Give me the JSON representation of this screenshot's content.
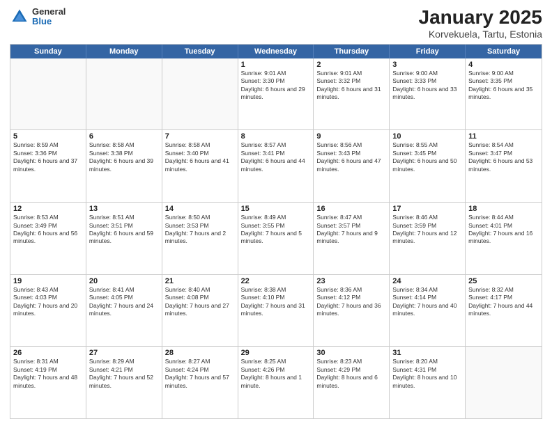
{
  "header": {
    "logo": {
      "general": "General",
      "blue": "Blue"
    },
    "title": "January 2025",
    "subtitle": "Korvekuela, Tartu, Estonia"
  },
  "weekdays": [
    "Sunday",
    "Monday",
    "Tuesday",
    "Wednesday",
    "Thursday",
    "Friday",
    "Saturday"
  ],
  "rows": [
    [
      {
        "day": "",
        "sunrise": "",
        "sunset": "",
        "daylight": "",
        "empty": true
      },
      {
        "day": "",
        "sunrise": "",
        "sunset": "",
        "daylight": "",
        "empty": true
      },
      {
        "day": "",
        "sunrise": "",
        "sunset": "",
        "daylight": "",
        "empty": true
      },
      {
        "day": "1",
        "sunrise": "Sunrise: 9:01 AM",
        "sunset": "Sunset: 3:30 PM",
        "daylight": "Daylight: 6 hours and 29 minutes."
      },
      {
        "day": "2",
        "sunrise": "Sunrise: 9:01 AM",
        "sunset": "Sunset: 3:32 PM",
        "daylight": "Daylight: 6 hours and 31 minutes."
      },
      {
        "day": "3",
        "sunrise": "Sunrise: 9:00 AM",
        "sunset": "Sunset: 3:33 PM",
        "daylight": "Daylight: 6 hours and 33 minutes."
      },
      {
        "day": "4",
        "sunrise": "Sunrise: 9:00 AM",
        "sunset": "Sunset: 3:35 PM",
        "daylight": "Daylight: 6 hours and 35 minutes."
      }
    ],
    [
      {
        "day": "5",
        "sunrise": "Sunrise: 8:59 AM",
        "sunset": "Sunset: 3:36 PM",
        "daylight": "Daylight: 6 hours and 37 minutes."
      },
      {
        "day": "6",
        "sunrise": "Sunrise: 8:58 AM",
        "sunset": "Sunset: 3:38 PM",
        "daylight": "Daylight: 6 hours and 39 minutes."
      },
      {
        "day": "7",
        "sunrise": "Sunrise: 8:58 AM",
        "sunset": "Sunset: 3:40 PM",
        "daylight": "Daylight: 6 hours and 41 minutes."
      },
      {
        "day": "8",
        "sunrise": "Sunrise: 8:57 AM",
        "sunset": "Sunset: 3:41 PM",
        "daylight": "Daylight: 6 hours and 44 minutes."
      },
      {
        "day": "9",
        "sunrise": "Sunrise: 8:56 AM",
        "sunset": "Sunset: 3:43 PM",
        "daylight": "Daylight: 6 hours and 47 minutes."
      },
      {
        "day": "10",
        "sunrise": "Sunrise: 8:55 AM",
        "sunset": "Sunset: 3:45 PM",
        "daylight": "Daylight: 6 hours and 50 minutes."
      },
      {
        "day": "11",
        "sunrise": "Sunrise: 8:54 AM",
        "sunset": "Sunset: 3:47 PM",
        "daylight": "Daylight: 6 hours and 53 minutes."
      }
    ],
    [
      {
        "day": "12",
        "sunrise": "Sunrise: 8:53 AM",
        "sunset": "Sunset: 3:49 PM",
        "daylight": "Daylight: 6 hours and 56 minutes."
      },
      {
        "day": "13",
        "sunrise": "Sunrise: 8:51 AM",
        "sunset": "Sunset: 3:51 PM",
        "daylight": "Daylight: 6 hours and 59 minutes."
      },
      {
        "day": "14",
        "sunrise": "Sunrise: 8:50 AM",
        "sunset": "Sunset: 3:53 PM",
        "daylight": "Daylight: 7 hours and 2 minutes."
      },
      {
        "day": "15",
        "sunrise": "Sunrise: 8:49 AM",
        "sunset": "Sunset: 3:55 PM",
        "daylight": "Daylight: 7 hours and 5 minutes."
      },
      {
        "day": "16",
        "sunrise": "Sunrise: 8:47 AM",
        "sunset": "Sunset: 3:57 PM",
        "daylight": "Daylight: 7 hours and 9 minutes."
      },
      {
        "day": "17",
        "sunrise": "Sunrise: 8:46 AM",
        "sunset": "Sunset: 3:59 PM",
        "daylight": "Daylight: 7 hours and 12 minutes."
      },
      {
        "day": "18",
        "sunrise": "Sunrise: 8:44 AM",
        "sunset": "Sunset: 4:01 PM",
        "daylight": "Daylight: 7 hours and 16 minutes."
      }
    ],
    [
      {
        "day": "19",
        "sunrise": "Sunrise: 8:43 AM",
        "sunset": "Sunset: 4:03 PM",
        "daylight": "Daylight: 7 hours and 20 minutes."
      },
      {
        "day": "20",
        "sunrise": "Sunrise: 8:41 AM",
        "sunset": "Sunset: 4:05 PM",
        "daylight": "Daylight: 7 hours and 24 minutes."
      },
      {
        "day": "21",
        "sunrise": "Sunrise: 8:40 AM",
        "sunset": "Sunset: 4:08 PM",
        "daylight": "Daylight: 7 hours and 27 minutes."
      },
      {
        "day": "22",
        "sunrise": "Sunrise: 8:38 AM",
        "sunset": "Sunset: 4:10 PM",
        "daylight": "Daylight: 7 hours and 31 minutes."
      },
      {
        "day": "23",
        "sunrise": "Sunrise: 8:36 AM",
        "sunset": "Sunset: 4:12 PM",
        "daylight": "Daylight: 7 hours and 36 minutes."
      },
      {
        "day": "24",
        "sunrise": "Sunrise: 8:34 AM",
        "sunset": "Sunset: 4:14 PM",
        "daylight": "Daylight: 7 hours and 40 minutes."
      },
      {
        "day": "25",
        "sunrise": "Sunrise: 8:32 AM",
        "sunset": "Sunset: 4:17 PM",
        "daylight": "Daylight: 7 hours and 44 minutes."
      }
    ],
    [
      {
        "day": "26",
        "sunrise": "Sunrise: 8:31 AM",
        "sunset": "Sunset: 4:19 PM",
        "daylight": "Daylight: 7 hours and 48 minutes."
      },
      {
        "day": "27",
        "sunrise": "Sunrise: 8:29 AM",
        "sunset": "Sunset: 4:21 PM",
        "daylight": "Daylight: 7 hours and 52 minutes."
      },
      {
        "day": "28",
        "sunrise": "Sunrise: 8:27 AM",
        "sunset": "Sunset: 4:24 PM",
        "daylight": "Daylight: 7 hours and 57 minutes."
      },
      {
        "day": "29",
        "sunrise": "Sunrise: 8:25 AM",
        "sunset": "Sunset: 4:26 PM",
        "daylight": "Daylight: 8 hours and 1 minute."
      },
      {
        "day": "30",
        "sunrise": "Sunrise: 8:23 AM",
        "sunset": "Sunset: 4:29 PM",
        "daylight": "Daylight: 8 hours and 6 minutes."
      },
      {
        "day": "31",
        "sunrise": "Sunrise: 8:20 AM",
        "sunset": "Sunset: 4:31 PM",
        "daylight": "Daylight: 8 hours and 10 minutes."
      },
      {
        "day": "",
        "sunrise": "",
        "sunset": "",
        "daylight": "",
        "empty": true
      }
    ]
  ]
}
